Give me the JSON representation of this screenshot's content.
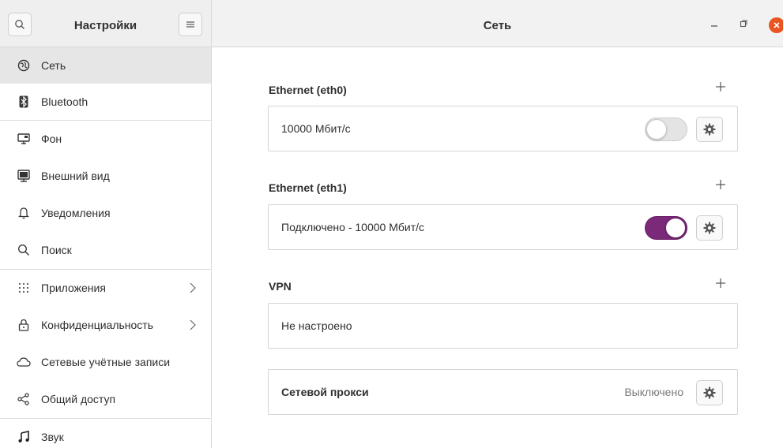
{
  "sidebar_header": {
    "title": "Настройки",
    "search_icon": "search-icon",
    "menu_icon": "hamburger-menu-icon"
  },
  "main_header": {
    "title": "Сеть",
    "controls": [
      "minimize-icon",
      "maximize-icon",
      "close-icon"
    ]
  },
  "sidebar": {
    "items": [
      {
        "label": "Сеть",
        "icon": "network-globe-icon",
        "active": true
      },
      {
        "label": "Bluetooth",
        "icon": "bluetooth-icon"
      },
      {
        "label": "Фон",
        "icon": "background-monitor-icon"
      },
      {
        "label": "Внешний вид",
        "icon": "appearance-icon"
      },
      {
        "label": "Уведомления",
        "icon": "bell-icon"
      },
      {
        "label": "Поиск",
        "icon": "search-icon"
      },
      {
        "label": "Приложения",
        "icon": "apps-grid-icon",
        "submenu": true
      },
      {
        "label": "Конфиденциальность",
        "icon": "lock-icon",
        "submenu": true
      },
      {
        "label": "Сетевые учётные записи",
        "icon": "cloud-icon"
      },
      {
        "label": "Общий доступ",
        "icon": "share-icon"
      },
      {
        "label": "Звук",
        "icon": "music-note-icon"
      }
    ]
  },
  "main": {
    "eth0": {
      "title": "Ethernet (eth0)",
      "status": "10000 Мбит/с",
      "toggle_on": false
    },
    "eth1": {
      "title": "Ethernet (eth1)",
      "status": "Подключено - 10000 Мбит/с",
      "toggle_on": true
    },
    "vpn": {
      "title": "VPN",
      "status": "Не настроено"
    },
    "proxy": {
      "label": "Сетевой прокси",
      "status": "Выключено"
    }
  },
  "colors": {
    "accent": "#7a2a78",
    "close_button": "#e95420",
    "active_item_bg": "#e6e6e6"
  }
}
